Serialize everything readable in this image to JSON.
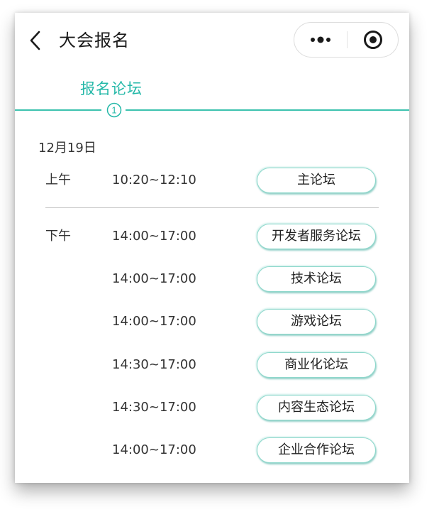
{
  "header": {
    "title": "大会报名",
    "icons": {
      "back": "back-chevron-icon",
      "more": "more-dots-icon",
      "close": "target-circle-icon"
    }
  },
  "steps": {
    "label": "报名论坛",
    "number": "1",
    "accent_color": "#24b8a8"
  },
  "schedule": {
    "date": "12月19日",
    "morning": {
      "label": "上午",
      "sessions": [
        {
          "time": "10:20~12:10",
          "forum": "主论坛"
        }
      ]
    },
    "afternoon": {
      "label": "下午",
      "sessions": [
        {
          "time": "14:00~17:00",
          "forum": "开发者服务论坛"
        },
        {
          "time": "14:00~17:00",
          "forum": "技术论坛"
        },
        {
          "time": "14:00~17:00",
          "forum": "游戏论坛"
        },
        {
          "time": "14:30~17:00",
          "forum": "商业化论坛"
        },
        {
          "time": "14:30~17:00",
          "forum": "内容生态论坛"
        },
        {
          "time": "14:00~17:00",
          "forum": "企业合作论坛"
        }
      ]
    }
  }
}
